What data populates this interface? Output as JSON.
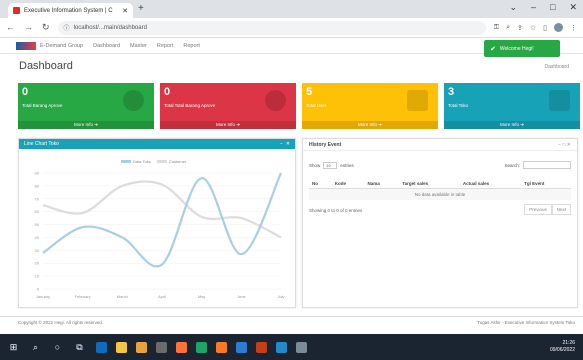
{
  "browser": {
    "tab_title": "Executive Information System | C",
    "url": "localhost/...main/dashboard"
  },
  "app": {
    "brand": "E-Demand Group",
    "menu": [
      "Dashboard",
      "Master",
      "Report",
      "Report"
    ]
  },
  "toast": {
    "message": "Welcome Hegi!"
  },
  "page": {
    "title": "Dashboard",
    "breadcrumb": "Dashboard"
  },
  "stats": [
    {
      "value": "0",
      "label": "Total Barang Aprove",
      "more": "More Info",
      "color": "#28a745"
    },
    {
      "value": "0",
      "label": "Total Total Barang Aprove",
      "more": "More Info",
      "color": "#dc3545"
    },
    {
      "value": "5",
      "label": "Total User",
      "more": "More Info",
      "color": "#ffc107"
    },
    {
      "value": "3",
      "label": "Total Toko",
      "more": "More Info",
      "color": "#17a2b8"
    }
  ],
  "line_card": {
    "title": "Line Chart Toko",
    "legend": [
      "Data Toko",
      "Customer"
    ]
  },
  "chart_data": {
    "type": "line",
    "categories": [
      "January",
      "February",
      "March",
      "April",
      "May",
      "June",
      "July"
    ],
    "ylim": [
      0,
      90
    ],
    "yticks": [
      "90",
      "80",
      "70",
      "60",
      "50",
      "40",
      "30",
      "20",
      "10",
      "0"
    ],
    "series": [
      {
        "name": "Data Toko",
        "values": [
          28,
          48,
          40,
          19,
          86,
          27,
          90
        ],
        "color": "#a9cfe2"
      },
      {
        "name": "Customer",
        "values": [
          65,
          59,
          80,
          81,
          56,
          55,
          40
        ],
        "color": "#dcdcdc"
      }
    ]
  },
  "history": {
    "title": "History Event",
    "show": "Show",
    "entries_value": "10",
    "entries": "entries",
    "search_label": "Search:",
    "columns": [
      "No",
      "Kode",
      "Nama",
      "Target sales",
      "Actual sales",
      "Tgl Event"
    ],
    "empty": "No data available in table",
    "info": "Showing 0 to 0 of 0 entries",
    "prev": "Previous",
    "next": "Next"
  },
  "footer": {
    "left": "Copyright © 2022 Hegi. All rights reserved.",
    "right": "Tugas Akhir - Executive Information System Toko"
  },
  "clock": {
    "time": "21:26",
    "date": "09/06/2022"
  }
}
